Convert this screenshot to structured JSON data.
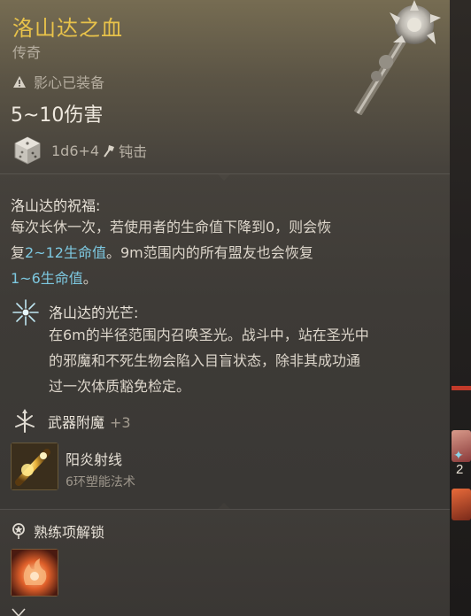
{
  "item": {
    "name": "洛山达之血",
    "rarity": "传奇",
    "equip_status": "影心已装备",
    "damage": "5~10伤害",
    "dice": "1d6+4",
    "damage_type": "钝击"
  },
  "blessing": {
    "title": "洛山达的祝福:",
    "line1": "每次长休一次，若使用者的生命值下降到0，则会恢",
    "line2_pre": "复",
    "line2_hl": "2~12生命值",
    "line2_post": "。9m范围内的所有盟友也会恢复",
    "line3_hl": "1~6生命值",
    "line3_post": "。"
  },
  "radiance": {
    "title": "洛山达的光芒:",
    "line1": "在6m的半径范围内召唤圣光。战斗中，站在圣光中",
    "line2": "的邪魔和不死生物会陷入目盲状态，除非其成功通",
    "line3": "过一次体质豁免检定。"
  },
  "enchant": {
    "label": "武器附魔",
    "value": "+3"
  },
  "spell": {
    "name": "阳炎射线",
    "subtitle": "6环塑能法术"
  },
  "proficiency": {
    "label": "熟练项解锁"
  },
  "side_panel": {
    "number": "2"
  },
  "colors": {
    "title": "#e8c24a",
    "highlight": "#7dc8e0"
  }
}
